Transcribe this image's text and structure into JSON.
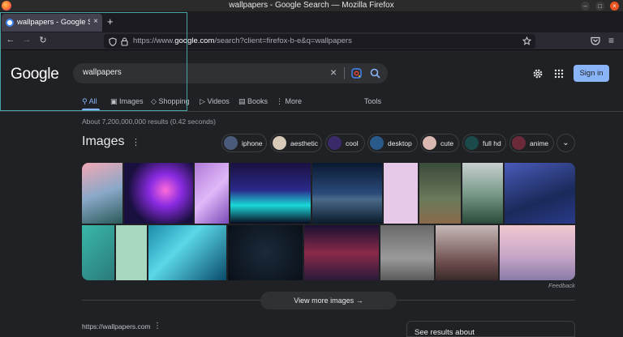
{
  "window": {
    "title": "wallpapers - Google Search — Mozilla Firefox",
    "controls": {
      "min": "–",
      "max": "□",
      "close": "×"
    }
  },
  "tab": {
    "label": "wallpapers - Google Search",
    "close": "×",
    "new_tab": "+"
  },
  "navbar": {
    "back": "←",
    "forward": "→",
    "reload": "↻",
    "url_prefix": "https://www.",
    "url_domain": "google.com",
    "url_rest": "/search?client=firefox-b-e&q=wallpapers"
  },
  "google": {
    "logo": "Google",
    "query": "wallpapers",
    "sign_in": "Sign in",
    "tabs": [
      {
        "label": "All",
        "icon": "search-icon"
      },
      {
        "label": "Images",
        "icon": "image-icon"
      },
      {
        "label": "Shopping",
        "icon": "tag-icon"
      },
      {
        "label": "Videos",
        "icon": "play-icon"
      },
      {
        "label": "Books",
        "icon": "book-icon"
      },
      {
        "label": "More",
        "icon": "more-vert-icon"
      }
    ],
    "tools": "Tools",
    "results_count": "About 7,200,000,000 results (0.42 seconds)",
    "images_heading": "Images",
    "chips": [
      {
        "label": "iphone",
        "color": "#4a5a7a"
      },
      {
        "label": "aesthetic",
        "color": "#d9c9b8"
      },
      {
        "label": "cool",
        "color": "#3a2a6a"
      },
      {
        "label": "desktop",
        "color": "#2a5a8a"
      },
      {
        "label": "cute",
        "color": "#d8b8b0"
      },
      {
        "label": "full hd",
        "color": "#1a4a4a"
      },
      {
        "label": "anime",
        "color": "#6a2a3a"
      }
    ],
    "feedback": "Feedback",
    "view_more": "View more images",
    "site_url": "https://wallpapers.com",
    "see_results_about": "See results about"
  },
  "colors": {
    "accent": "#8ab4f8",
    "bg": "#202124"
  }
}
